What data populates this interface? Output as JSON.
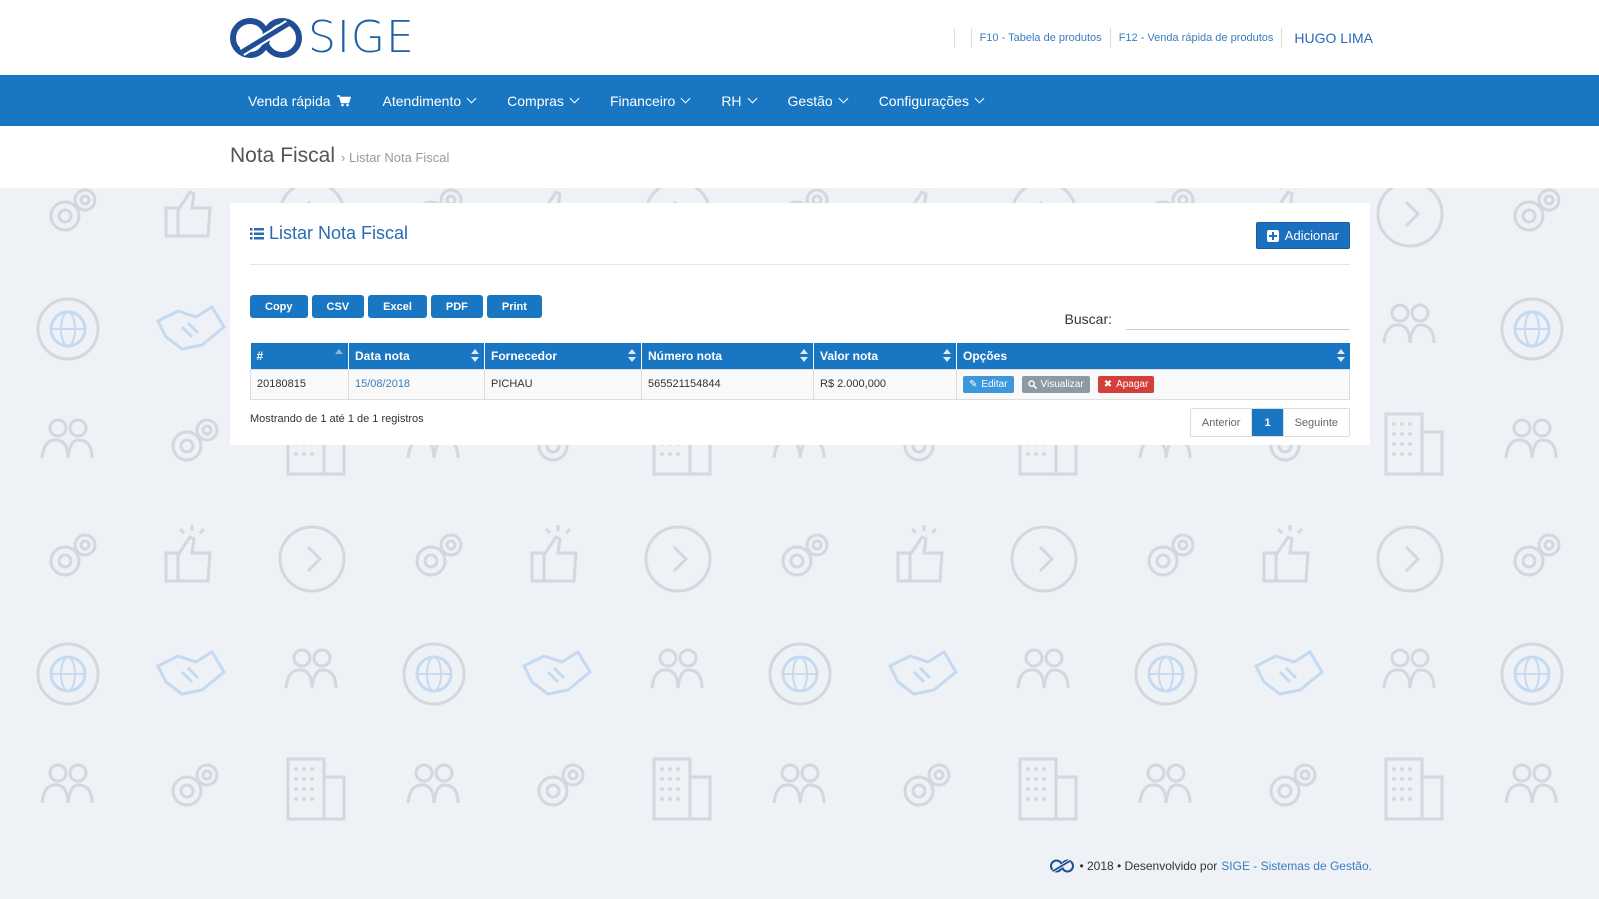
{
  "brand": {
    "name": "SIGE"
  },
  "toplinks": {
    "f10": "F10 - Tabela de produtos",
    "f12": "F12 - Venda rápida de produtos",
    "user": "HUGO LIMA"
  },
  "nav": {
    "items": [
      {
        "label": "Venda rápida"
      },
      {
        "label": "Atendimento"
      },
      {
        "label": "Compras"
      },
      {
        "label": "Financeiro"
      },
      {
        "label": "RH"
      },
      {
        "label": "Gestão"
      },
      {
        "label": "Configurações"
      }
    ]
  },
  "page": {
    "title": "Nota Fiscal",
    "breadcrumb": "› Listar Nota Fiscal"
  },
  "panel": {
    "title": "Listar Nota Fiscal",
    "add_label": "Adicionar",
    "export_buttons": [
      "Copy",
      "CSV",
      "Excel",
      "PDF",
      "Print"
    ],
    "search_label": "Buscar:",
    "search_value": ""
  },
  "table": {
    "columns": [
      "#",
      "Data nota",
      "Fornecedor",
      "Número nota",
      "Valor nota",
      "Opções"
    ],
    "rows": [
      {
        "id": "20180815",
        "date": "15/08/2018",
        "supplier": "PICHAU",
        "number": "565521154844",
        "value": "R$ 2.000,000"
      }
    ],
    "actions": {
      "edit": "Editar",
      "view": "Visualizar",
      "delete": "Apagar"
    }
  },
  "pagination": {
    "info": "Mostrando de 1 até 1 de 1 registros",
    "prev": "Anterior",
    "current": "1",
    "next": "Seguinte"
  },
  "footer": {
    "text": "• 2018 • Desenvolvido por",
    "link": "SIGE - Sistemas de Gestão."
  },
  "colors": {
    "primary": "#1976c2",
    "brand": "#1f5ea8",
    "danger": "#d43f3a",
    "muted": "#8c9aa6",
    "info": "#3c97dd"
  }
}
